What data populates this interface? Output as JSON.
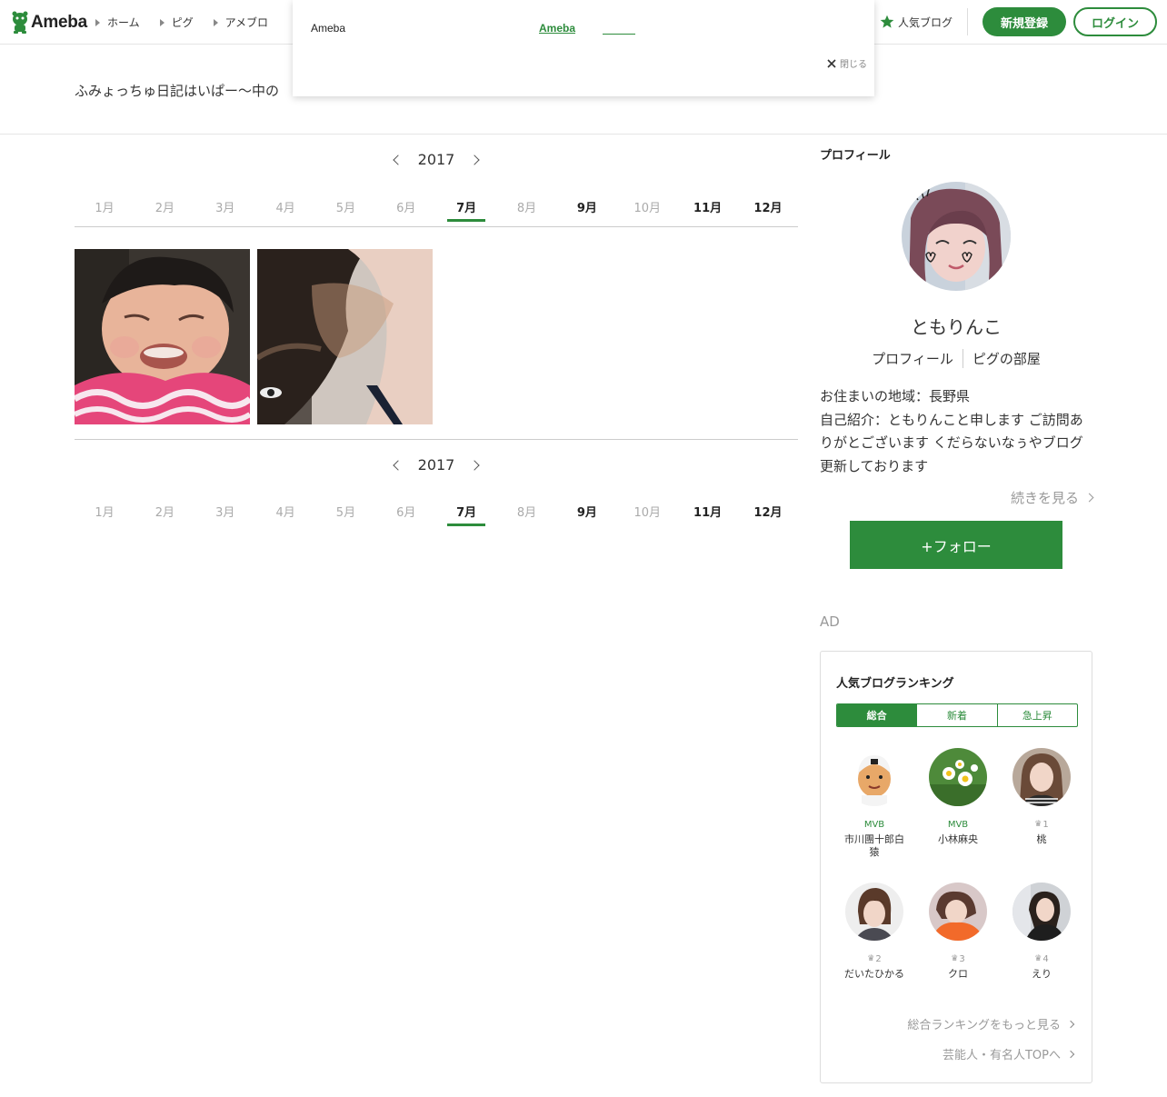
{
  "header": {
    "logo_text": "Ameba",
    "nav": [
      "ホーム",
      "ピグ",
      "アメブロ"
    ],
    "popular_blog": "人気ブログ",
    "register": "新規登録",
    "login": "ログイン"
  },
  "popup": {
    "brand": "Ameba",
    "link": "Ameba",
    "close_label": "閉じる"
  },
  "blog_title": "ふみょっちゅ日記はいぱー〜中の",
  "calendar": {
    "year": "2017",
    "months": [
      "1月",
      "2月",
      "3月",
      "4月",
      "5月",
      "6月",
      "7月",
      "8月",
      "9月",
      "10月",
      "11月",
      "12月"
    ],
    "bold_months": [
      "7月",
      "9月",
      "11月",
      "12月"
    ],
    "active_month": "7月"
  },
  "sidebar": {
    "heading": "プロフィール",
    "name": "ともりんこ",
    "link_profile": "プロフィール",
    "link_pig": "ピグの部屋",
    "text_line1": "お住まいの地域：長野県",
    "text_line2": "自己紹介：ともりんこと申します ご訪問ありがとございます くだらないなぅやブログ更新しております",
    "more": "続きを見る",
    "follow": "+フォロー",
    "ad": "AD"
  },
  "ranking": {
    "title": "人気ブログランキング",
    "tabs": [
      "総合",
      "新着",
      "急上昇"
    ],
    "items": [
      {
        "badge": "MVB",
        "name": "市川團十郎白猿"
      },
      {
        "badge": "MVB",
        "name": "小林麻央"
      },
      {
        "badge": "1",
        "name": "桃"
      },
      {
        "badge": "2",
        "name": "だいたひかる"
      },
      {
        "badge": "3",
        "name": "クロ"
      },
      {
        "badge": "4",
        "name": "えり"
      }
    ],
    "more_overall": "総合ランキングをもっと見る",
    "more_celeb": "芸能人・有名人TOPへ"
  },
  "colors": {
    "accent": "#2d8c3c"
  }
}
